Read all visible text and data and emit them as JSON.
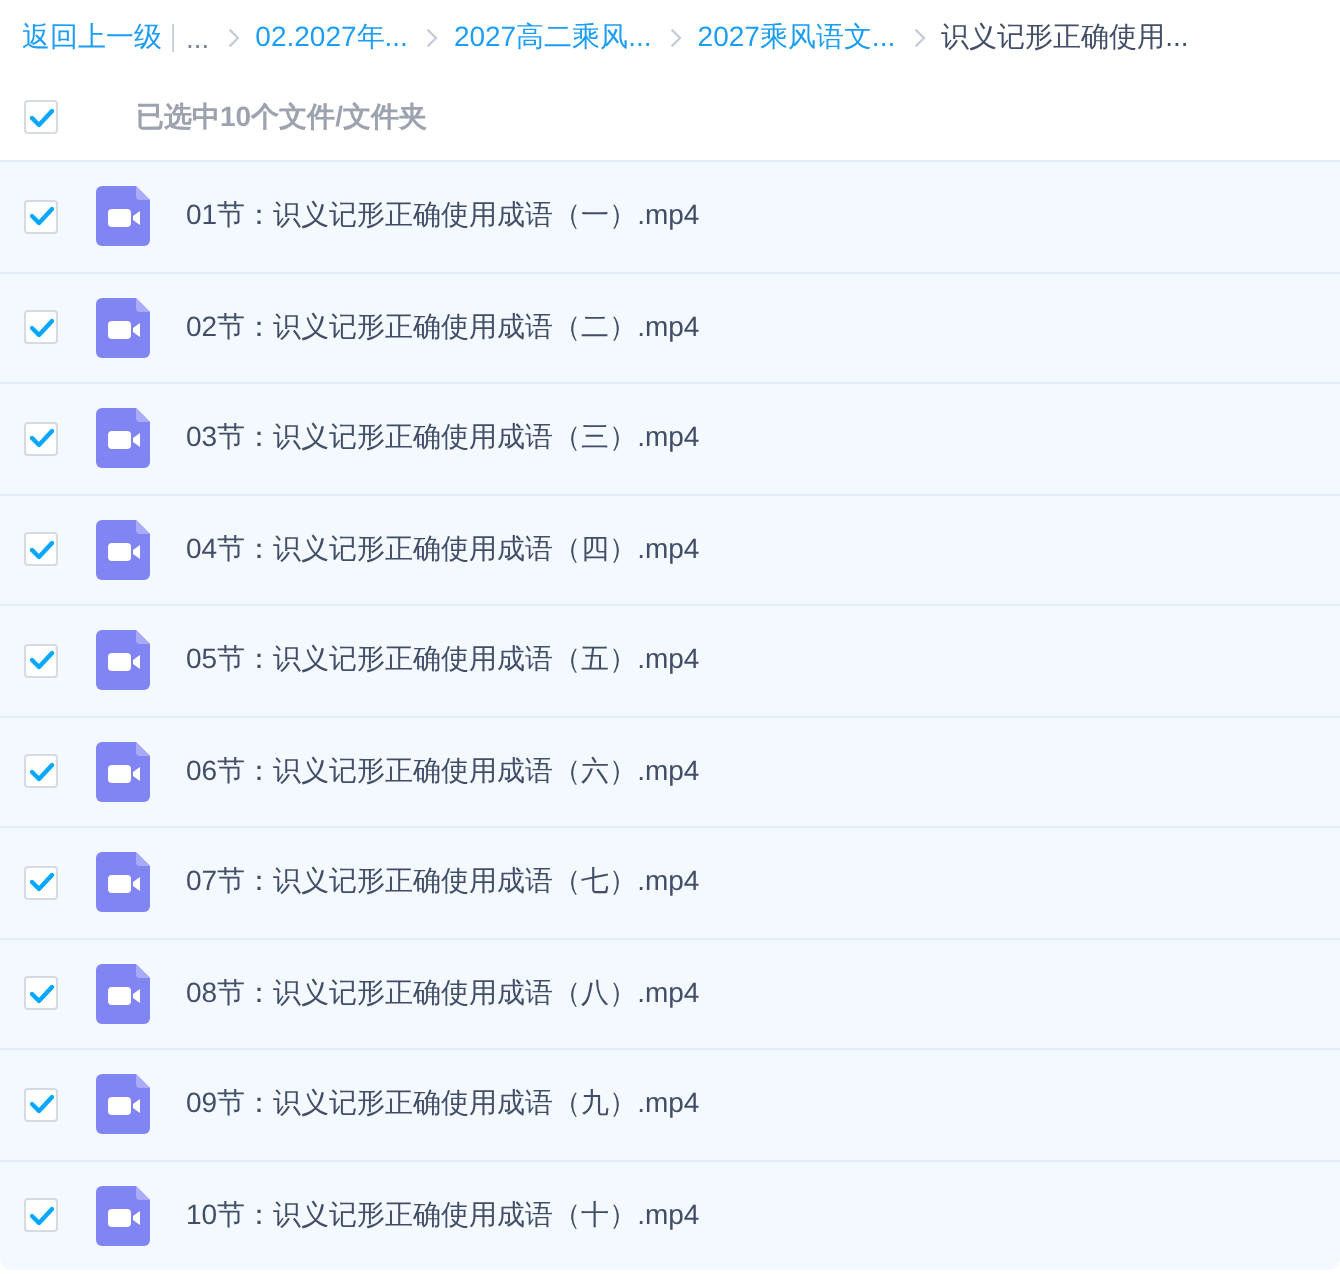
{
  "breadcrumb": {
    "back": "返回上一级",
    "ellipsis": "...",
    "items": [
      {
        "label": "02.2027年...",
        "current": false
      },
      {
        "label": "2027高二乘风...",
        "current": false
      },
      {
        "label": "2027乘风语文...",
        "current": false
      },
      {
        "label": "识义记形正确使用...",
        "current": true
      }
    ]
  },
  "header": {
    "checked": true,
    "label": "已选中10个文件/文件夹"
  },
  "files": [
    {
      "kind": "video",
      "checked": true,
      "name": "01节：识义记形正确使用成语（一）.mp4"
    },
    {
      "kind": "video",
      "checked": true,
      "name": "02节：识义记形正确使用成语（二）.mp4"
    },
    {
      "kind": "video",
      "checked": true,
      "name": "03节：识义记形正确使用成语（三）.mp4"
    },
    {
      "kind": "video",
      "checked": true,
      "name": "04节：识义记形正确使用成语（四）.mp4"
    },
    {
      "kind": "video",
      "checked": true,
      "name": "05节：识义记形正确使用成语（五）.mp4"
    },
    {
      "kind": "video",
      "checked": true,
      "name": "06节：识义记形正确使用成语（六）.mp4"
    },
    {
      "kind": "video",
      "checked": true,
      "name": "07节：识义记形正确使用成语（七）.mp4"
    },
    {
      "kind": "video",
      "checked": true,
      "name": "08节：识义记形正确使用成语（八）.mp4"
    },
    {
      "kind": "video",
      "checked": true,
      "name": "09节：识义记形正确使用成语（九）.mp4"
    },
    {
      "kind": "video",
      "checked": true,
      "name": "10节：识义记形正确使用成语（十）.mp4"
    }
  ]
}
